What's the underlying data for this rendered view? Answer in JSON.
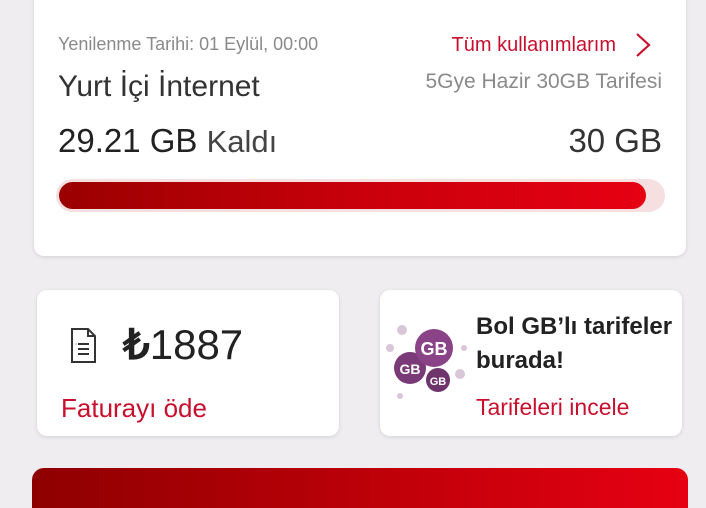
{
  "usage": {
    "renewal_date": "Yenilenme Tarihi: 01 Eylül, 00:00",
    "all_usage_link": "Tüm kullanımlarım",
    "category": "Yurt İçi İnternet",
    "tariff_name": "5Gye Hazir 30GB Tarifesi",
    "remaining_amount": "29.21 GB",
    "remaining_suffix": "Kaldı",
    "total": "30 GB",
    "remaining_fraction": 0.9737
  },
  "bill": {
    "currency_symbol": "₺",
    "amount": "1887",
    "pay_link": "Faturayı öde",
    "icon": "document-icon"
  },
  "promo": {
    "headline": "Bol GB’lı tarifeler burada!",
    "link": "Tarifeleri incele",
    "illustration_labels": [
      "GB",
      "GB",
      "GB"
    ]
  },
  "colors": {
    "accent": "#c8102e",
    "bar_start": "#9a0000",
    "bar_end": "#e60012",
    "background": "#efedf0"
  }
}
